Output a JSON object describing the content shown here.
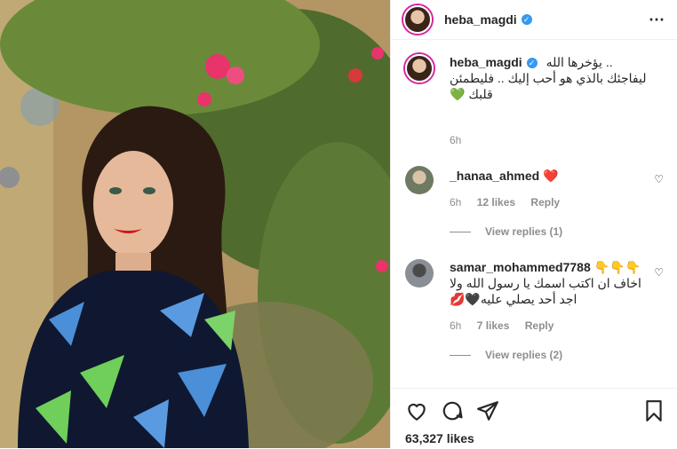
{
  "post": {
    "username": "heba_magdi",
    "more_icon": "⋯",
    "likes_text": "63,327 likes"
  },
  "caption": {
    "username": "heba_magdi",
    "line1": "يؤخرها الله ..",
    "line2": "ليفاجئك بالذي هو أحب إليك .. فليطمئن",
    "line3": "قلبك",
    "emoji": "💚",
    "time": "6h"
  },
  "comments": [
    {
      "username": "_hanaa_ahmed",
      "text": "",
      "emoji": "❤️",
      "time": "6h",
      "likes": "12 likes",
      "reply": "Reply",
      "view_replies": "View replies (1)"
    },
    {
      "username": "samar_mohammed7788",
      "emoji_after_name": "👇👇👇",
      "line1": "اخاف ان اكتب اسمك يا رسول الله ولا",
      "line2": "اجد أحد يصلي عليه🖤💋",
      "time": "6h",
      "likes": "7 likes",
      "reply": "Reply",
      "view_replies": "View replies (2)"
    }
  ],
  "colors": {
    "accent": "#3897f0",
    "ring": "#d6249f",
    "muted": "#8e8e8e"
  }
}
